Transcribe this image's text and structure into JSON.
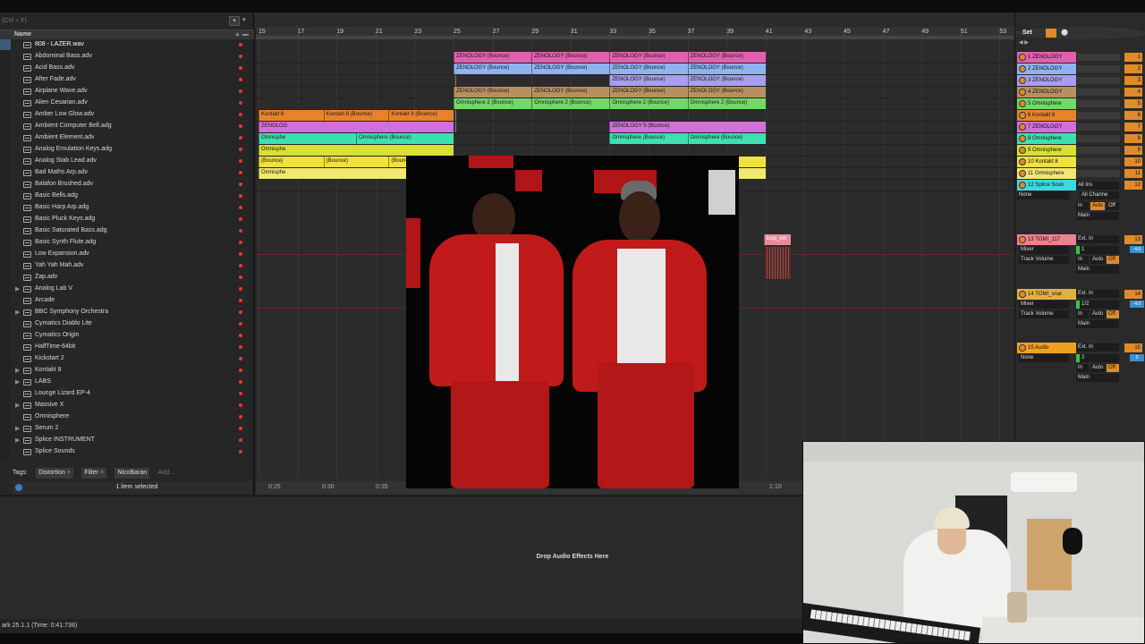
{
  "browser": {
    "search_hint": "(Ctrl + F)",
    "column_name": "Name",
    "items": [
      {
        "label": "808 - LAZER.wav",
        "folder": false,
        "expand": false
      },
      {
        "label": "Abdominal Bass.adv",
        "folder": false,
        "expand": false
      },
      {
        "label": "Acid Bass.adv",
        "folder": false,
        "expand": false
      },
      {
        "label": "After Fade.adv",
        "folder": false,
        "expand": false
      },
      {
        "label": "Airplane Wave.adv",
        "folder": false,
        "expand": false
      },
      {
        "label": "Alien Cesarian.adv",
        "folder": false,
        "expand": false
      },
      {
        "label": "Amber Low Glow.adv",
        "folder": false,
        "expand": false
      },
      {
        "label": "Ambient Computer Bell.adg",
        "folder": false,
        "expand": false
      },
      {
        "label": "Ambient Element.adv",
        "folder": false,
        "expand": false
      },
      {
        "label": "Analog Emulation Keys.adg",
        "folder": false,
        "expand": false
      },
      {
        "label": "Analog Stab Lead.adv",
        "folder": false,
        "expand": false
      },
      {
        "label": "Bad Maths Arp.adv",
        "folder": false,
        "expand": false
      },
      {
        "label": "Balafon Brushed.adv",
        "folder": false,
        "expand": false
      },
      {
        "label": "Basic Bells.adg",
        "folder": false,
        "expand": false
      },
      {
        "label": "Basic Harp Arp.adg",
        "folder": false,
        "expand": false
      },
      {
        "label": "Basic Pluck Keys.adg",
        "folder": false,
        "expand": false
      },
      {
        "label": "Basic Saturated Bass.adg",
        "folder": false,
        "expand": false
      },
      {
        "label": "Basic Synth Flute.adg",
        "folder": false,
        "expand": false
      },
      {
        "label": "Low Expansion.adv",
        "folder": false,
        "expand": false
      },
      {
        "label": "Yah Yah Mah.adv",
        "folder": false,
        "expand": false
      },
      {
        "label": "Zap.adv",
        "folder": false,
        "expand": false
      },
      {
        "label": "Analog Lab V",
        "folder": true,
        "expand": true
      },
      {
        "label": "Arcade",
        "folder": true,
        "expand": false
      },
      {
        "label": "BBC Symphony Orchestra",
        "folder": true,
        "expand": true
      },
      {
        "label": "Cymatics Diablo Lite",
        "folder": true,
        "expand": false
      },
      {
        "label": "Cymatics Origin",
        "folder": true,
        "expand": false
      },
      {
        "label": "HalfTime-64bit",
        "folder": true,
        "expand": false
      },
      {
        "label": "Kickstart 2",
        "folder": true,
        "expand": false
      },
      {
        "label": "Kontakt 8",
        "folder": true,
        "expand": true
      },
      {
        "label": "LABS",
        "folder": true,
        "expand": true
      },
      {
        "label": "Lounge Lizard EP-4",
        "folder": true,
        "expand": false
      },
      {
        "label": "Massive X",
        "folder": true,
        "expand": true
      },
      {
        "label": "Omnisphere",
        "folder": true,
        "expand": false
      },
      {
        "label": "Serum 2",
        "folder": true,
        "expand": true
      },
      {
        "label": "Splice INSTRUMENT",
        "folder": true,
        "expand": true
      },
      {
        "label": "Splice Sounds",
        "folder": true,
        "expand": false
      }
    ],
    "tags_label": "Tags:",
    "tags": [
      "Distortion",
      "Filter",
      "NicoBaran"
    ],
    "tags_add": "Add...",
    "selection_status": "1 item selected"
  },
  "ruler": {
    "bars": [
      "15",
      "17",
      "19",
      "21",
      "23",
      "25",
      "27",
      "29",
      "31",
      "33",
      "35",
      "37",
      "39",
      "41",
      "43",
      "45",
      "47",
      "49",
      "51",
      "53"
    ],
    "time": [
      "0:25",
      "0:30",
      "0:35",
      "1:10"
    ]
  },
  "clips": [
    {
      "lane": 0,
      "bar": 25,
      "len": 16,
      "label": "ZENOLOGY (Bounce)",
      "color": "#e060b0",
      "split": 4
    },
    {
      "lane": 1,
      "bar": 25,
      "len": 16,
      "label": "ZENOLOGY (Bounce)",
      "color": "#8fb3f0",
      "split": 4
    },
    {
      "lane": 2,
      "bar": 33,
      "len": 8,
      "label": "ZENOLOGY (Bounce)",
      "color": "#a89ef0",
      "split": 2
    },
    {
      "lane": 3,
      "bar": 25,
      "len": 16,
      "label": "ZENOLOGY (Bounce)",
      "color": "#b89060",
      "split": 4
    },
    {
      "lane": 4,
      "bar": 25,
      "len": 16,
      "label": "Omnisphere 2 (Bounce)",
      "color": "#6fd96a",
      "split": 4
    },
    {
      "lane": 5,
      "bar": 15,
      "len": 10,
      "label": "Kontakt 8 (Bounce)",
      "color": "#e8822a",
      "split": 3,
      "first": "Kontakt 8"
    },
    {
      "lane": 6,
      "bar": 15,
      "len": 10,
      "label": "ZENOLOGY 5 (Bounce)",
      "color": "#d070d8",
      "split": 1,
      "first": "ZENOLOG"
    },
    {
      "lane": 6,
      "bar": 33,
      "len": 8,
      "label": "ZENOLOGY 5 (Bounce)",
      "color": "#d070d8",
      "split": 1
    },
    {
      "lane": 7,
      "bar": 15,
      "len": 10,
      "label": "Omnisphere (Bounce)",
      "color": "#3de0b0",
      "split": 2,
      "first": "Omnisphe"
    },
    {
      "lane": 7,
      "bar": 33,
      "len": 8,
      "label": "Omnisphere (Bounce)",
      "color": "#3de0b0",
      "split": 2
    },
    {
      "lane": 8,
      "bar": 15,
      "len": 10,
      "label": "Omnisphere (Bounce)",
      "color": "#d8e030",
      "split": 1,
      "first": "Omnisphe"
    },
    {
      "lane": 9,
      "bar": 15,
      "len": 10,
      "label": "(Bounce)",
      "color": "#f0e040",
      "split": 3
    },
    {
      "lane": 9,
      "bar": 39,
      "len": 2,
      "label": "",
      "color": "#f0e040",
      "split": 1
    },
    {
      "lane": 10,
      "bar": 15,
      "len": 10,
      "label": "Omnisphere (Bounce)",
      "color": "#f0e870",
      "split": 1,
      "first": "Omnisphe"
    },
    {
      "lane": 10,
      "bar": 39,
      "len": 2,
      "label": "",
      "color": "#f0e870",
      "split": 1
    }
  ],
  "loop_clip_label": "loop_intr",
  "mixer": {
    "set_label": "Set",
    "tracks": [
      {
        "name": "1 ZENOLOGY",
        "color": "#e060b0",
        "num": "1"
      },
      {
        "name": "2 ZENOLOGY",
        "color": "#8fb3f0",
        "num": "2"
      },
      {
        "name": "3 ZENOLOGY",
        "color": "#a89ef0",
        "num": "3"
      },
      {
        "name": "4 ZENOLOGY",
        "color": "#b89060",
        "num": "4"
      },
      {
        "name": "5 Omnisphere",
        "color": "#6fd96a",
        "num": "5"
      },
      {
        "name": "6 Kontakt 8",
        "color": "#e8822a",
        "num": "6"
      },
      {
        "name": "7 ZENOLOGY",
        "color": "#d070d8",
        "num": "7"
      },
      {
        "name": "8 Omnisphere",
        "color": "#3de0b0",
        "num": "8"
      },
      {
        "name": "9 Omnisphere",
        "color": "#d8e030",
        "num": "9"
      },
      {
        "name": "10 Kontakt 8",
        "color": "#f0e040",
        "num": "10"
      },
      {
        "name": "11 Omnisphere",
        "color": "#f0e870",
        "num": "11"
      },
      {
        "name": "12 Splice Soun",
        "color": "#40d8e0",
        "num": "12"
      }
    ],
    "track12": {
      "in": "All Ins",
      "ch": "All Channe",
      "none": "None",
      "mon_in": "In",
      "mon_auto": "Auto",
      "mon_off": "Off",
      "out": "Main",
      "vol": "0"
    },
    "track13": {
      "name": "13 TOMI_117",
      "color": "#f08090",
      "num": "13",
      "in": "Ext. In",
      "mixer": "Mixer",
      "ch": "1",
      "tv": "Track Volume",
      "mon_in": "In",
      "mon_auto": "Auto",
      "mon_off": "Off",
      "out": "Main",
      "vol": "-4.0"
    },
    "track14": {
      "name": "14 TOMI_snar",
      "color": "#e0b040",
      "num": "14",
      "in": "Ext. In",
      "mixer": "Mixer",
      "ch": "1/2",
      "tv": "Track Volume",
      "mon_in": "In",
      "mon_auto": "Auto",
      "mon_off": "Off",
      "out": "Main",
      "vol": "-4.0"
    },
    "track15": {
      "name": "15 Audio",
      "color": "#f0a020",
      "num": "15",
      "in": "Ext. In",
      "none": "None",
      "ch": "2",
      "mon_in": "In",
      "mon_auto": "Auto",
      "mon_off": "Off",
      "out": "Main",
      "vol": "0"
    }
  },
  "detail": {
    "drop_message": "Drop Audio Effects Here"
  },
  "status_bar": {
    "text": "ark 25.1.1 (Time: 0:41:738)"
  }
}
